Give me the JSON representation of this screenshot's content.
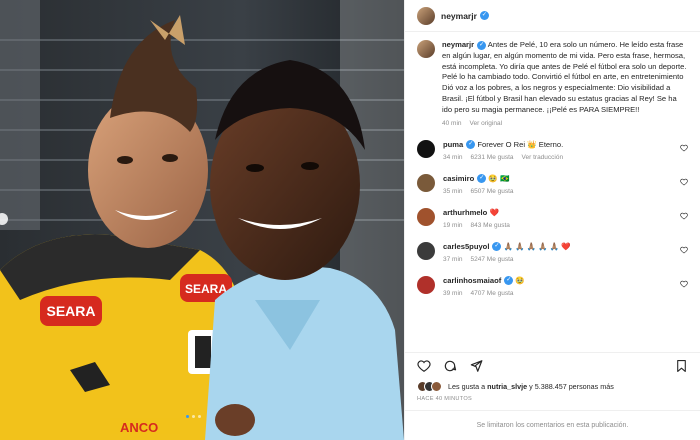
{
  "post": {
    "author": "neymarjr",
    "photo_alt": "Photo",
    "photo_brand": "SEARA",
    "photo_banner": "ANCO"
  },
  "caption": {
    "username": "neymarjr",
    "text": "Antes de Pelé, 10 era solo un número. He leído esta frase en algún lugar, en algún momento de mi vida. Pero esta frase, hermosa, está incompleta. Yo diría que antes de Pelé el fútbol era solo un deporte. Pelé lo ha cambiado todo. Convirtió el fútbol en arte, en entretenimiento Dió voz a los pobres, a los negros y especialmente: Dio visibilidad a Brasil. ¡El fútbol y Brasil han elevado su estatus gracias al Rey! Se ha ido pero su magia permanece. ¡¡Pelé es PARA SIEMPRE!!",
    "time": "40 min",
    "see_original": "Ver original"
  },
  "comments": [
    {
      "username": "puma",
      "text": "Forever O Rei 👑 Eterno.",
      "time": "34 min",
      "likes": "6231 Me gusta",
      "extra": "Ver traducción",
      "color": "#111111"
    },
    {
      "username": "casimiro",
      "text": "🥹 🇧🇷",
      "time": "35 min",
      "likes": "6507 Me gusta",
      "extra": "",
      "color": "#7a5a3a"
    },
    {
      "username": "arthurhmelo",
      "text": "❤️",
      "time": "19 min",
      "likes": "843 Me gusta",
      "extra": "",
      "color": "#a0522d"
    },
    {
      "username": "carles5puyol",
      "text": "🙏🏽 🙏🏽 🙏🏽 🙏🏽 🙏🏽 ❤️",
      "time": "37 min",
      "likes": "5247 Me gusta",
      "extra": "",
      "color": "#3b3b3b"
    },
    {
      "username": "carlinhosmaiaof",
      "text": "🥹",
      "time": "39 min",
      "likes": "4707 Me gusta",
      "extra": "",
      "color": "#b0302a"
    }
  ],
  "likes": {
    "text_prefix": "Les gusta a",
    "user": "nutria_slvje",
    "text_suffix": "y 5.388.457 personas más"
  },
  "ago": "HACE 40 MINUTOS",
  "limited": "Se limitaron los comentarios en esta publicación."
}
